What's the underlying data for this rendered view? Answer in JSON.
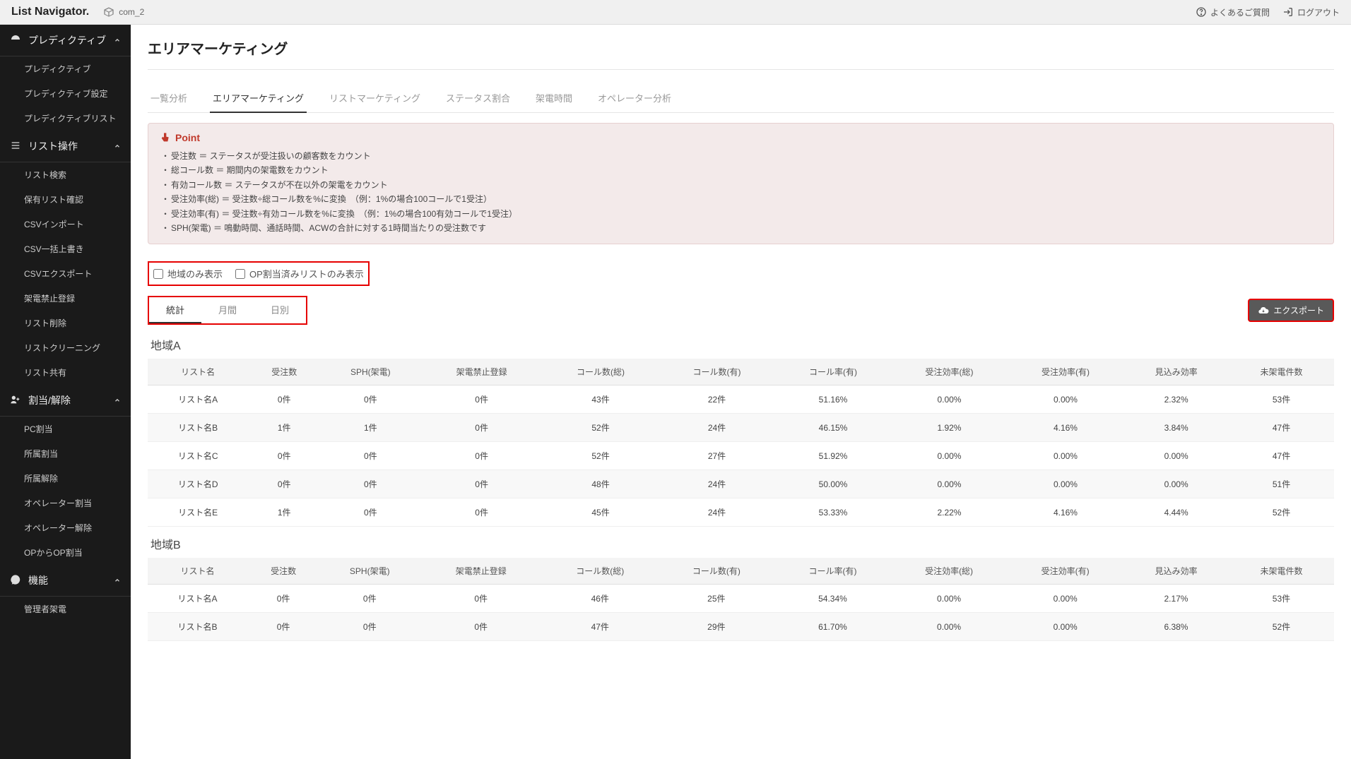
{
  "app": {
    "logo": "List Navigator.",
    "company": "com_2"
  },
  "topbar": {
    "faq": "よくあるご質問",
    "logout": "ログアウト"
  },
  "sidebar": {
    "sections": [
      {
        "title": "プレディクティブ",
        "items": [
          "プレディクティブ",
          "プレディクティブ設定",
          "プレディクティブリスト"
        ]
      },
      {
        "title": "リスト操作",
        "items": [
          "リスト検索",
          "保有リスト確認",
          "CSVインポート",
          "CSV一括上書き",
          "CSVエクスポート",
          "架電禁止登録",
          "リスト削除",
          "リストクリーニング",
          "リスト共有"
        ]
      },
      {
        "title": "割当/解除",
        "items": [
          "PC割当",
          "所属割当",
          "所属解除",
          "オペレーター割当",
          "オペレーター解除",
          "OPからOP割当"
        ]
      },
      {
        "title": "機能",
        "items": [
          "管理者架電"
        ]
      }
    ]
  },
  "page": {
    "title": "エリアマーケティング"
  },
  "main_tabs": [
    "一覧分析",
    "エリアマーケティング",
    "リストマーケティング",
    "ステータス割合",
    "架電時間",
    "オペレーター分析"
  ],
  "main_tab_active": 1,
  "point": {
    "label": "Point",
    "items": [
      "受注数 ＝ ステータスが受注扱いの顧客数をカウント",
      "総コール数 ＝ 期間内の架電数をカウント",
      "有効コール数 ＝ ステータスが不在以外の架電をカウント",
      "受注効率(総) ＝ 受注数÷総コール数を%に変換　（例：1%の場合100コールで1受注）",
      "受注効率(有) ＝ 受注数÷有効コール数を%に変換　（例：1%の場合100有効コールで1受注）",
      "SPH(架電) ＝ 鳴動時間、通話時間、ACWの合計に対する1時間当たりの受注数です"
    ]
  },
  "filters": {
    "region_only": "地域のみ表示",
    "op_assigned_only": "OP割当済みリストのみ表示"
  },
  "subtabs": [
    "統計",
    "月間",
    "日別"
  ],
  "subtab_active": 0,
  "export_label": "エクスポート",
  "table": {
    "columns": [
      "リスト名",
      "受注数",
      "SPH(架電)",
      "架電禁止登録",
      "コール数(総)",
      "コール数(有)",
      "コール率(有)",
      "受注効率(総)",
      "受注効率(有)",
      "見込み効率",
      "未架電件数"
    ]
  },
  "regions": [
    {
      "name": "地域A",
      "rows": [
        [
          "リスト名A",
          "0件",
          "0件",
          "0件",
          "43件",
          "22件",
          "51.16%",
          "0.00%",
          "0.00%",
          "2.32%",
          "53件"
        ],
        [
          "リスト名B",
          "1件",
          "1件",
          "0件",
          "52件",
          "24件",
          "46.15%",
          "1.92%",
          "4.16%",
          "3.84%",
          "47件"
        ],
        [
          "リスト名C",
          "0件",
          "0件",
          "0件",
          "52件",
          "27件",
          "51.92%",
          "0.00%",
          "0.00%",
          "0.00%",
          "47件"
        ],
        [
          "リスト名D",
          "0件",
          "0件",
          "0件",
          "48件",
          "24件",
          "50.00%",
          "0.00%",
          "0.00%",
          "0.00%",
          "51件"
        ],
        [
          "リスト名E",
          "1件",
          "0件",
          "0件",
          "45件",
          "24件",
          "53.33%",
          "2.22%",
          "4.16%",
          "4.44%",
          "52件"
        ]
      ]
    },
    {
      "name": "地域B",
      "rows": [
        [
          "リスト名A",
          "0件",
          "0件",
          "0件",
          "46件",
          "25件",
          "54.34%",
          "0.00%",
          "0.00%",
          "2.17%",
          "53件"
        ],
        [
          "リスト名B",
          "0件",
          "0件",
          "0件",
          "47件",
          "29件",
          "61.70%",
          "0.00%",
          "0.00%",
          "6.38%",
          "52件"
        ]
      ]
    }
  ]
}
